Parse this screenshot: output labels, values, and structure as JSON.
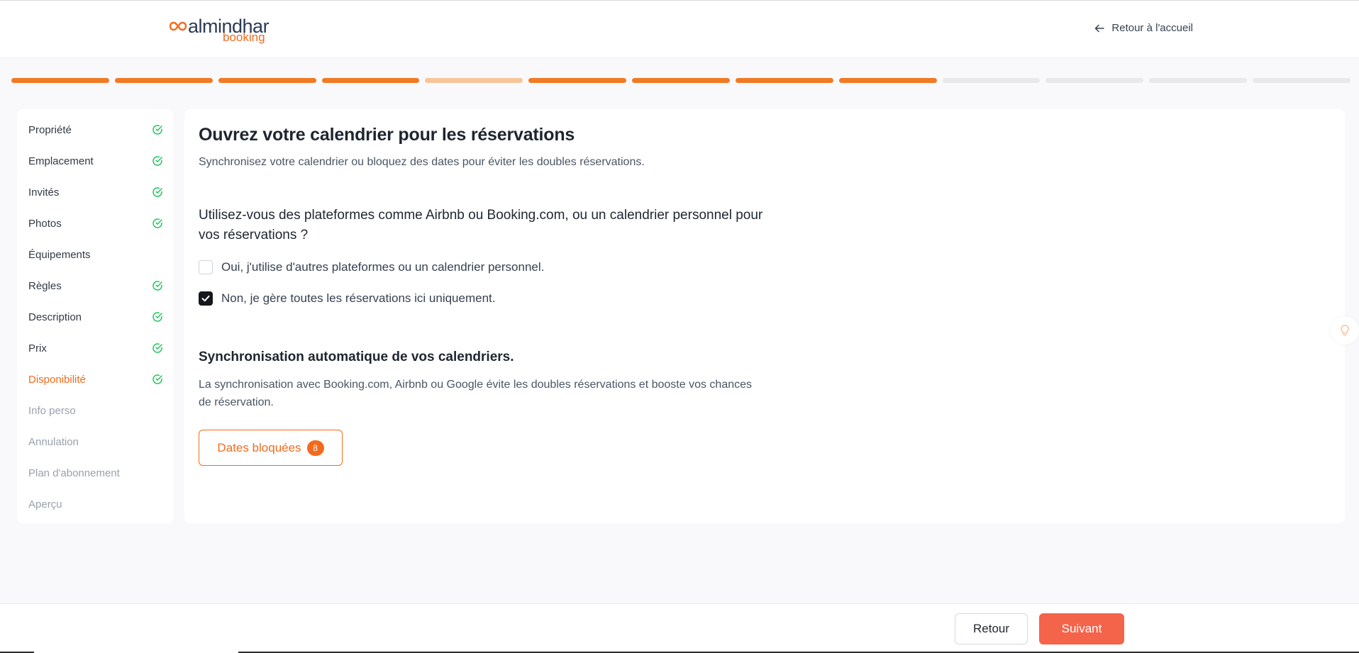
{
  "header": {
    "logo_main": "almindhar",
    "logo_sub": "booking",
    "back_home_label": "Retour à l'accueil"
  },
  "progress": {
    "total_steps": 13,
    "states": [
      "done",
      "done",
      "done",
      "done",
      "light",
      "done",
      "done",
      "done",
      "done",
      "todo",
      "todo",
      "todo",
      "todo"
    ],
    "accent_color": "#f07a24"
  },
  "sidebar": {
    "items": [
      {
        "label": "Propriété",
        "state": "complete"
      },
      {
        "label": "Emplacement",
        "state": "complete"
      },
      {
        "label": "Invités",
        "state": "complete"
      },
      {
        "label": "Photos",
        "state": "complete"
      },
      {
        "label": "Équipements",
        "state": "default"
      },
      {
        "label": "Règles",
        "state": "complete"
      },
      {
        "label": "Description",
        "state": "complete"
      },
      {
        "label": "Prix",
        "state": "complete"
      },
      {
        "label": "Disponibilité",
        "state": "active-complete"
      },
      {
        "label": "Info perso",
        "state": "pending"
      },
      {
        "label": "Annulation",
        "state": "pending"
      },
      {
        "label": "Plan d'abonnement",
        "state": "pending"
      },
      {
        "label": "Aperçu",
        "state": "pending"
      }
    ]
  },
  "main": {
    "title": "Ouvrez votre calendrier pour les réservations",
    "subtitle": "Synchronisez votre calendrier ou bloquez des dates pour éviter les doubles réservations.",
    "question": "Utilisez-vous des plateformes comme Airbnb ou Booking.com, ou un calendrier personnel pour vos réservations ?",
    "options": [
      {
        "label": "Oui, j'utilise d'autres plateformes ou un calendrier personnel.",
        "checked": false
      },
      {
        "label": "Non, je gère toutes les réservations ici uniquement.",
        "checked": true
      }
    ],
    "sync_title": "Synchronisation automatique de vos calendriers.",
    "sync_text": "La synchronisation avec Booking.com, Airbnb ou Google évite les doubles réservations et booste vos chances de réservation.",
    "blocked_dates_label": "Dates bloquées",
    "blocked_dates_count": "8"
  },
  "footer": {
    "back_label": "Retour",
    "next_label": "Suivant"
  },
  "colors": {
    "brand_orange": "#f26b1d",
    "next_button": "#f4644a",
    "check_green": "#22c55e"
  }
}
